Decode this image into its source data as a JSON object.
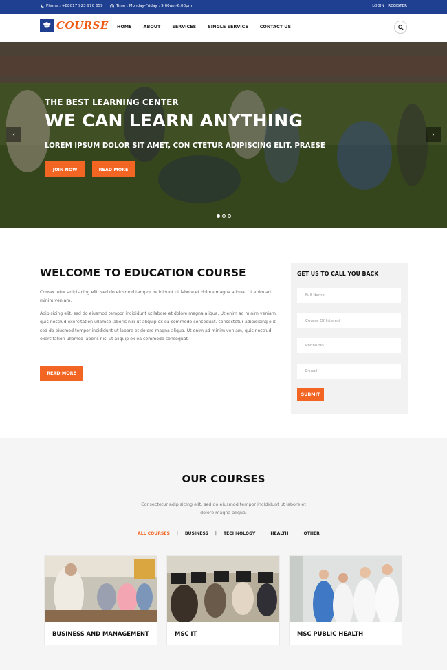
{
  "topbar": {
    "phone": "Phone : +88017 923 970 659",
    "time": "Time : Monday-Friday : 9:00am-6:00pm",
    "auth": "LOGIN | REGISTER"
  },
  "brand": {
    "logo_text": "COURSE"
  },
  "nav": {
    "items": [
      "HOME",
      "ABOUT",
      "SERVICES",
      "SINGLE SERVICE",
      "CONTACT US"
    ]
  },
  "hero": {
    "subtitle": "THE BEST LEARNING CENTER",
    "title": "WE CAN LEARN ANYTHING",
    "description": "LOREM IPSUM DOLOR SIT AMET, CON CTETUR ADIPISCING ELIT. PRAESE",
    "button_join": "JOIN NOW",
    "button_read": "READ MORE",
    "prev": "‹",
    "next": "›",
    "slides": 3,
    "active_slide": 1
  },
  "welcome": {
    "title": "WELCOME TO EDUCATION COURSE",
    "paragraph1": "Consectetur adipisicing elit, sed do eiusmod tempor incididunt ut labore et dolore magna aliqua. Ut enim ad minim veniam.",
    "paragraph2": "Adipisicing elit, sed do eiusmod tempor incididunt ut labore et dolore magna aliqua. Ut enim ad minim veniam, quis nostrud exercitation ullamco laboris nisi ut aliquip ex ea commodo consequat. consectetur adipisicing elit, sed do eiusmod tempor incididunt ut labore et dolore magna aliqua. Ut enim ad minim veniam, quis nostrud exercitation ullamco laboris nisi ut aliquip ex ea commodo consequat.",
    "button": "READ MORE"
  },
  "callback": {
    "title": "GET US TO CALL YOU BACK",
    "full_name_placeholder": "Full Name",
    "course_placeholder": "Course Of Interest",
    "phone_placeholder": "Phone No",
    "email_placeholder": "E-mail",
    "submit": "SUBMIT"
  },
  "courses": {
    "title": "OUR COURSES",
    "description": "Consectetur adipisicing elit, sed do eiusmod tempor incididunt ut labore et dolore magna aliqua.",
    "filters": [
      "ALL COURSES",
      "BUSINESS",
      "TECHNOLOGY",
      "HEALTH",
      "OTHER"
    ],
    "active_filter": "ALL COURSES",
    "cards": [
      {
        "title": "BUSINESS AND MANAGEMENT"
      },
      {
        "title": "MSC IT"
      },
      {
        "title": "MSC PUBLIC HEALTH"
      }
    ]
  },
  "colors": {
    "brand_blue": "#1f3f91",
    "accent_orange": "#f26522"
  }
}
